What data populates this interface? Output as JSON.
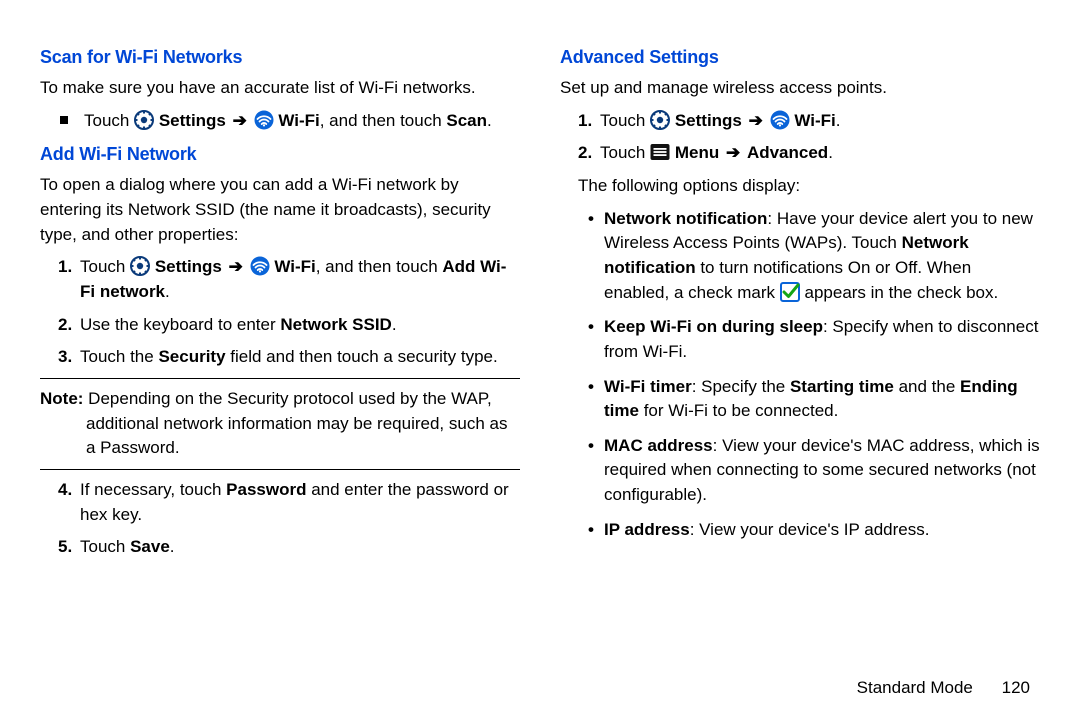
{
  "footer": {
    "mode": "Standard Mode",
    "page": "120"
  },
  "left": {
    "scan_heading": "Scan for Wi-Fi Networks",
    "scan_intro": "To make sure you have an accurate list of Wi-Fi networks.",
    "scan_step": {
      "pre": "Touch ",
      "settings": "Settings",
      "arrow": "➔",
      "wifi": "Wi-Fi",
      "tail": ", and then touch ",
      "scan": "Scan",
      "end": "."
    },
    "add_heading": "Add Wi-Fi Network",
    "add_intro": "To open a dialog where you can add a Wi-Fi network by entering its Network SSID (the name it broadcasts), security type, and other properties:",
    "add_steps": {
      "s1": {
        "pre": "Touch ",
        "settings": "Settings",
        "arrow": "➔",
        "wifi": "Wi-Fi",
        "tail": ", and then touch ",
        "addnet": "Add Wi-Fi network",
        "end": "."
      },
      "s2": {
        "pre": "Use the keyboard to enter ",
        "ssid": "Network SSID",
        "end": "."
      },
      "s3": {
        "pre": "Touch the ",
        "sec": "Security",
        "tail": " field and then touch a security type."
      },
      "s4": {
        "pre": "If necessary, touch ",
        "pw": "Password",
        "tail": " and enter the password or hex key."
      },
      "s5": {
        "pre": "Touch ",
        "save": "Save",
        "end": "."
      }
    },
    "note": {
      "label": "Note:",
      "text": " Depending on the Security protocol used by the WAP, additional network information may be required, such as a Password."
    }
  },
  "right": {
    "adv_heading": "Advanced Settings",
    "adv_intro": "Set up and manage wireless access points.",
    "adv_steps": {
      "s1": {
        "pre": "Touch ",
        "settings": "Settings",
        "arrow": "➔",
        "wifi": "Wi-Fi",
        "end": "."
      },
      "s2": {
        "pre": "Touch ",
        "menu": "Menu",
        "arrow": "➔",
        "advanced": "Advanced",
        "end": "."
      }
    },
    "options_intro": "The following options display:",
    "options": {
      "o1": {
        "t1": "Network notification",
        "t2": ": Have your device alert you to new Wireless Access Points (WAPs). Touch ",
        "t3": "Network notification",
        "t4": " to turn notifications On or Off. When enabled, a check mark ",
        "t5": " appears in the check box."
      },
      "o2": {
        "t1": "Keep Wi-Fi on during sleep",
        "t2": ": Specify when to disconnect from Wi-Fi."
      },
      "o3": {
        "t1": "Wi-Fi timer",
        "t2": ": Specify the ",
        "t3": "Starting time",
        "t4": " and the ",
        "t5": "Ending time",
        "t6": " for Wi-Fi to be connected."
      },
      "o4": {
        "t1": "MAC address",
        "t2": ": View your device's MAC address, which is required when connecting to some secured networks (not configurable)."
      },
      "o5": {
        "t1": "IP address",
        "t2": ": View your device's IP address."
      }
    }
  }
}
